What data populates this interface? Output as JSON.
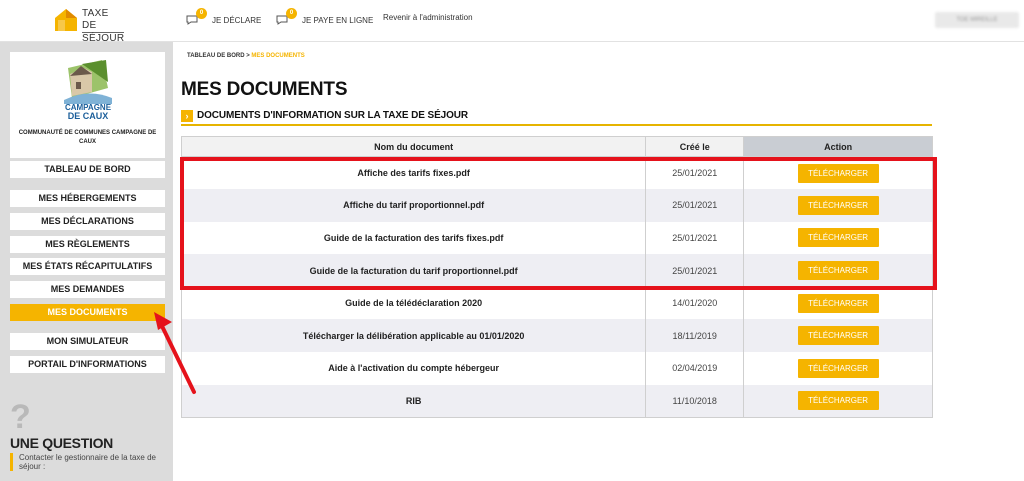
{
  "header": {
    "logo": {
      "line1": "TAXE DE",
      "line2": "SÉJOUR"
    },
    "nav": [
      {
        "label": "JE DÉCLARE",
        "badge": "0"
      },
      {
        "label": "JE PAYE EN LIGNE",
        "badge": "0"
      },
      {
        "label": "Revenir à l'administration"
      }
    ],
    "user_label": "TOE MIREILLE"
  },
  "sidebar": {
    "org_logo_text": {
      "line1": "CAMPAGNE",
      "line2": "DE CAUX"
    },
    "org_name": "COMMUNAUTÉ DE COMMUNES CAMPAGNE DE CAUX",
    "menu": [
      {
        "label": "TABLEAU DE BORD"
      },
      {
        "label": "MES HÉBERGEMENTS"
      },
      {
        "label": "MES DÉCLARATIONS"
      },
      {
        "label": "MES RÈGLEMENTS"
      },
      {
        "label": "MES ÉTATS RÉCAPITULATIFS"
      },
      {
        "label": "MES DEMANDES"
      },
      {
        "label": "MES DOCUMENTS"
      },
      {
        "label": "MON SIMULATEUR"
      },
      {
        "label": "PORTAIL D'INFORMATIONS"
      }
    ],
    "active_item": "MES DOCUMENTS",
    "question": {
      "mark": "?",
      "title": "UNE QUESTION",
      "text": "Contacter le gestionnaire de la taxe de séjour :"
    }
  },
  "breadcrumb": {
    "root": "TABLEAU DE BORD",
    "separator": ">",
    "current": "MES DOCUMENTS"
  },
  "page_title": "MES DOCUMENTS",
  "section": {
    "arrow": "›",
    "title": "DOCUMENTS D'INFORMATION SUR LA TAXE DE SÉJOUR"
  },
  "table": {
    "headers": [
      "Nom du document",
      "Créé le",
      "Action"
    ],
    "rows": [
      {
        "name": "Affiche des tarifs fixes.pdf",
        "date": "25/01/2021",
        "action": "TÉLÉCHARGER"
      },
      {
        "name": "Affiche du tarif proportionnel.pdf",
        "date": "25/01/2021",
        "action": "TÉLÉCHARGER"
      },
      {
        "name": "Guide de la facturation des tarifs fixes.pdf",
        "date": "25/01/2021",
        "action": "TÉLÉCHARGER"
      },
      {
        "name": "Guide de la facturation du tarif proportionnel.pdf",
        "date": "25/01/2021",
        "action": "TÉLÉCHARGER"
      },
      {
        "name": "Guide de la télédéclaration 2020",
        "date": "14/01/2020",
        "action": "TÉLÉCHARGER"
      },
      {
        "name": "Télécharger la délibération applicable au 01/01/2020",
        "date": "18/11/2019",
        "action": "TÉLÉCHARGER"
      },
      {
        "name": "Aide à l'activation du compte hébergeur",
        "date": "02/04/2019",
        "action": "TÉLÉCHARGER"
      },
      {
        "name": "RIB",
        "date": "11/10/2018",
        "action": "TÉLÉCHARGER"
      }
    ]
  },
  "colors": {
    "accent": "#f5b400",
    "annotation": "#e5121b",
    "sidebar_bg": "#dcdcdc"
  }
}
